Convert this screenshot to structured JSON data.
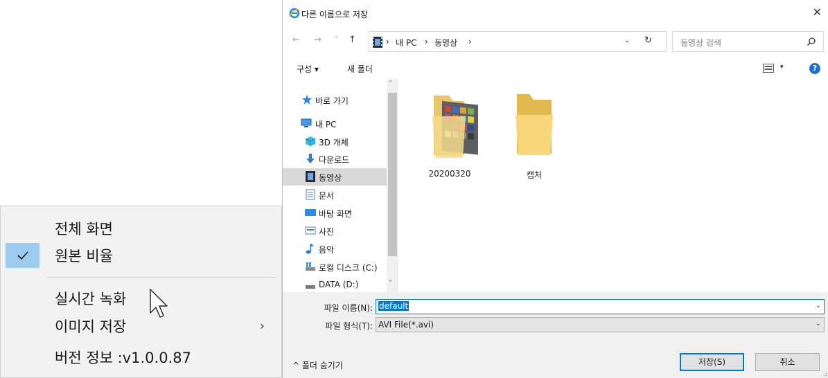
{
  "context_menu": {
    "items": [
      {
        "label": "전체 화면",
        "checked": false,
        "submenu": false
      },
      {
        "label": "원본 비율",
        "checked": true,
        "submenu": false
      },
      {
        "label": "실시간 녹화",
        "checked": false,
        "submenu": false
      },
      {
        "label": "이미지 저장",
        "checked": false,
        "submenu": true
      },
      {
        "label": "버전 정보 :v1.0.0.87",
        "checked": false,
        "submenu": false
      }
    ],
    "check_glyph": "✓",
    "submenu_glyph": "›"
  },
  "dialog": {
    "title": "다른 이름으로 저장",
    "close_glyph": "✕",
    "nav": {
      "back_glyph": "←",
      "forward_glyph": "→",
      "recent_glyph": "˅",
      "up_glyph": "↑",
      "breadcrumb": [
        "내 PC",
        "동영상"
      ],
      "separator": "›",
      "refresh_glyph": "↻",
      "dropdown_glyph": "⌄",
      "search_placeholder": "동영상 검색"
    },
    "toolbar": {
      "organize_label": "구성 ▾",
      "new_folder_label": "새 폴더",
      "view_dropdown": "▾",
      "help_label": "?"
    },
    "nav_pane": {
      "items": [
        {
          "label": "바로 가기",
          "icon": "star-icon"
        },
        {
          "label": "내 PC",
          "icon": "pc-icon"
        },
        {
          "label": "3D 개체",
          "icon": "cube-icon"
        },
        {
          "label": "다운로드",
          "icon": "download-icon"
        },
        {
          "label": "동영상",
          "icon": "video-icon",
          "selected": true
        },
        {
          "label": "문서",
          "icon": "document-icon"
        },
        {
          "label": "바탕 화면",
          "icon": "desktop-icon"
        },
        {
          "label": "사진",
          "icon": "picture-icon"
        },
        {
          "label": "음악",
          "icon": "music-icon"
        },
        {
          "label": "로컬 디스크 (C:)",
          "icon": "local-disk-icon"
        },
        {
          "label": "DATA (D:)",
          "icon": "drive-icon"
        }
      ],
      "scroll_up": "˄",
      "scroll_down": "˅"
    },
    "folders": [
      {
        "name": "20200320",
        "has_thumbnail": true
      },
      {
        "name": "캡처",
        "has_thumbnail": false
      }
    ],
    "filename": {
      "label": "파일 이름(N):",
      "value": "default"
    },
    "filetype": {
      "label": "파일 형식(T):",
      "value": "AVI File(*.avi)"
    },
    "hide_folders_label": "^ 폴더 숨기기",
    "save_label": "저장(S)",
    "cancel_label": "취소",
    "colors": {
      "accent": "#0078d7",
      "selection": "#d9d9d9",
      "menu_check_bg": "#9ecbf0"
    }
  }
}
